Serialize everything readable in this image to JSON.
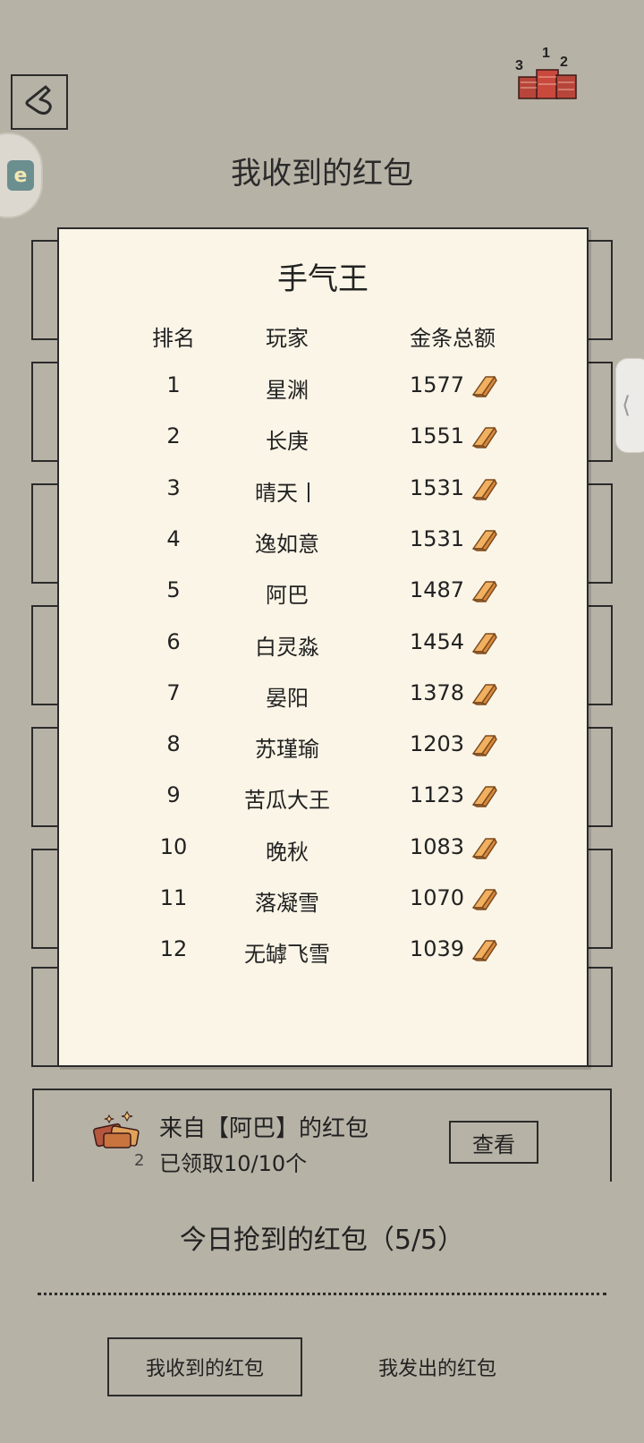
{
  "header": {
    "back_icon": "back-arrow-icon",
    "podium_icon": "ranking-podium-icon",
    "podium_numbers": [
      "3",
      "1",
      "2"
    ],
    "title": "我收到的红包"
  },
  "side_widget": {
    "icon": "app-widget-icon",
    "text": "e"
  },
  "side_handle": {
    "icon": "chevron-left-icon",
    "glyph": "⟨"
  },
  "leaderboard": {
    "title": "手气王",
    "columns": [
      "排名",
      "玩家",
      "金条总额"
    ],
    "rows": [
      {
        "rank": "1",
        "player": "星渊",
        "amount": "1577"
      },
      {
        "rank": "2",
        "player": "长庚",
        "amount": "1551"
      },
      {
        "rank": "3",
        "player": "晴天丨",
        "amount": "1531"
      },
      {
        "rank": "4",
        "player": "逸如意",
        "amount": "1531"
      },
      {
        "rank": "5",
        "player": "阿巴",
        "amount": "1487"
      },
      {
        "rank": "6",
        "player": "白灵淼",
        "amount": "1454"
      },
      {
        "rank": "7",
        "player": "晏阳",
        "amount": "1378"
      },
      {
        "rank": "8",
        "player": "苏瑾瑜",
        "amount": "1203"
      },
      {
        "rank": "9",
        "player": "苦瓜大王",
        "amount": "1123"
      },
      {
        "rank": "10",
        "player": "晚秋",
        "amount": "1083"
      },
      {
        "rank": "11",
        "player": "落凝雪",
        "amount": "1070"
      },
      {
        "rank": "12",
        "player": "无罅飞雪",
        "amount": "1039"
      }
    ],
    "amount_icon": "gold-bar-icon"
  },
  "packet": {
    "icon": "red-packet-gold-icon",
    "count": "2",
    "from": "来自【阿巴】的红包",
    "status": "已领取10/10个",
    "view_label": "查看"
  },
  "today": {
    "label": "今日抢到的红包（5/5）"
  },
  "tabs": {
    "received": "我收到的红包",
    "sent": "我发出的红包"
  },
  "colors": {
    "background": "#b7b2a6",
    "card": "#fbf5e7",
    "ink": "#2b2b2b",
    "gold": "#e8a552"
  }
}
